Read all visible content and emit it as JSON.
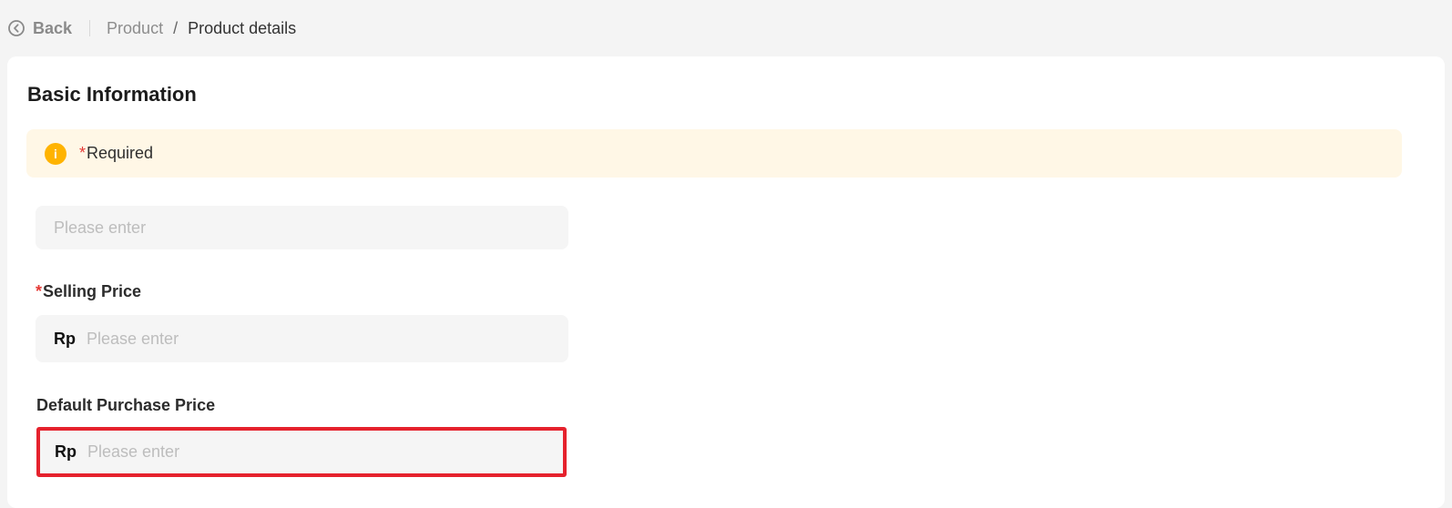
{
  "topbar": {
    "back_label": "Back",
    "breadcrumbs": [
      "Product",
      "Product details"
    ],
    "separator": "/"
  },
  "section": {
    "title": "Basic Information"
  },
  "notice": {
    "star": "*",
    "text": "Required",
    "icon": "warning-icon",
    "icon_glyph": "i"
  },
  "fields": {
    "first": {
      "placeholder": "Please enter"
    },
    "selling_price": {
      "star": "*",
      "label": "Selling Price",
      "prefix": "Rp",
      "placeholder": "Please enter"
    },
    "default_purchase_price": {
      "label": "Default Purchase Price",
      "prefix": "Rp",
      "placeholder": "Please enter"
    }
  },
  "colors": {
    "background": "#f4f4f4",
    "card": "#ffffff",
    "notice_bg": "#fff7e6",
    "notice_icon": "#ffb300",
    "required_star": "#e53935",
    "highlight_border": "#e5222d"
  }
}
